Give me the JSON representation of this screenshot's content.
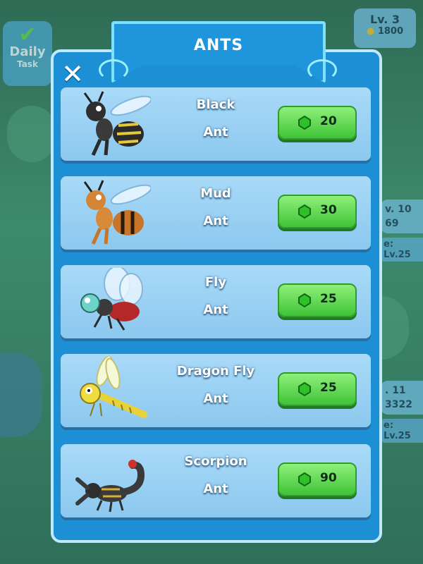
{
  "panel": {
    "title": "ANTS"
  },
  "background": {
    "daily": {
      "line1": "Daily",
      "line2": "Task"
    },
    "level": {
      "label": "Lv. 3",
      "coins": "1800"
    },
    "peek1": {
      "label": "v. 10",
      "value": "69",
      "req": "e: Lv.25"
    },
    "peek2": {
      "label": ". 11",
      "value": "3322",
      "req": "e: Lv.25"
    }
  },
  "ants": [
    {
      "name_line1": "Black",
      "name_line2": "Ant",
      "price": "20",
      "icon": "black-ant-icon",
      "color": "#2b2b2b"
    },
    {
      "name_line1": "Mud",
      "name_line2": "Ant",
      "price": "30",
      "icon": "mud-ant-icon",
      "color": "#c8752a"
    },
    {
      "name_line1": "Fly",
      "name_line2": "Ant",
      "price": "25",
      "icon": "fly-ant-icon",
      "color": "#b5282a"
    },
    {
      "name_line1": "Dragon Fly",
      "name_line2": "Ant",
      "price": "25",
      "icon": "dragonfly-ant-icon",
      "color": "#e8d23a"
    },
    {
      "name_line1": "Scorpion",
      "name_line2": "Ant",
      "price": "90",
      "icon": "scorpion-ant-icon",
      "color": "#3a3a3a"
    }
  ],
  "colors": {
    "panel": "#1d8fd5",
    "row": "#9cd2f4",
    "buy": "#4fd13f",
    "gem": "#2ec12a"
  }
}
